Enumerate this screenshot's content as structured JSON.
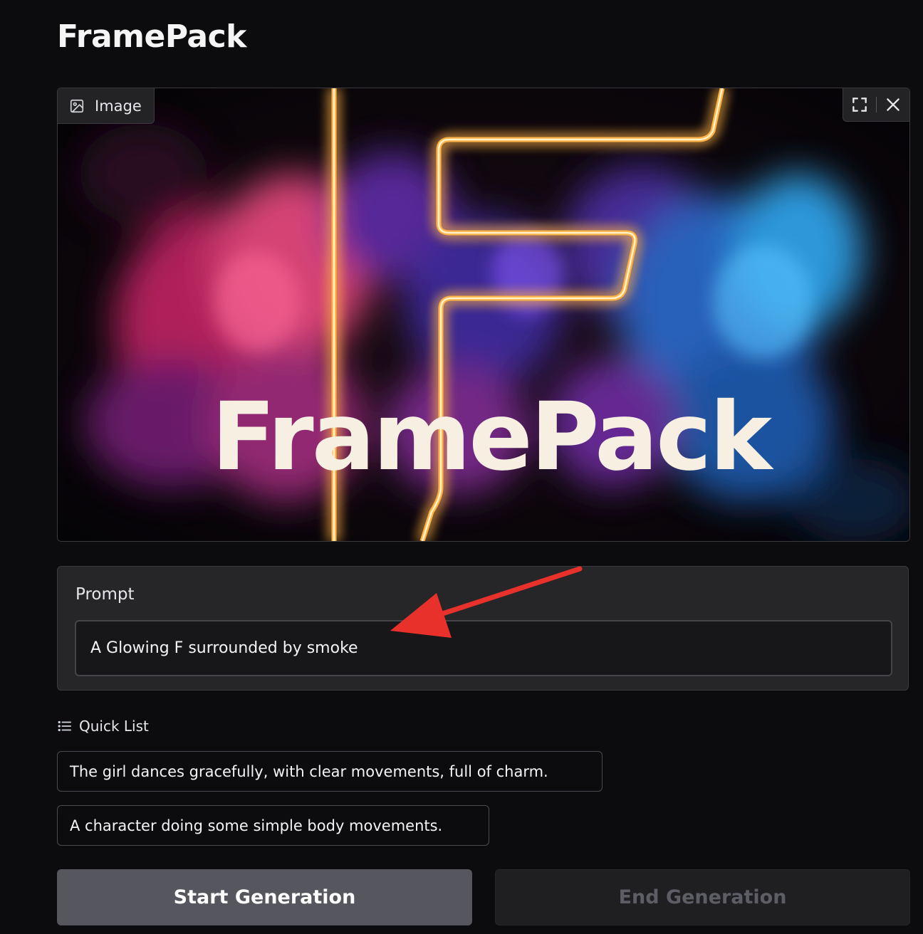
{
  "app": {
    "title": "FramePack"
  },
  "image_panel": {
    "label": "Image",
    "label_icon": "image-icon",
    "tools": [
      "fullscreen-icon",
      "close-icon"
    ],
    "artwork_text": "FramePack"
  },
  "prompt": {
    "label": "Prompt",
    "value": "A Glowing F surrounded by smoke",
    "placeholder": ""
  },
  "annotation": {
    "color": "#e8312a",
    "points_to": "prompt-input"
  },
  "quick_list": {
    "title": "Quick List",
    "icon": "list-icon",
    "items": [
      "The girl dances gracefully, with clear movements, full of charm.",
      "A character doing some simple body movements."
    ]
  },
  "actions": {
    "start_label": "Start Generation",
    "end_label": "End Generation",
    "end_disabled": true
  },
  "colors": {
    "background": "#0c0c0f",
    "panel": "#262629",
    "neon_orange": "#ff9a2e",
    "smoke_magenta": "#c42a7c",
    "smoke_blue": "#2a74c8"
  }
}
